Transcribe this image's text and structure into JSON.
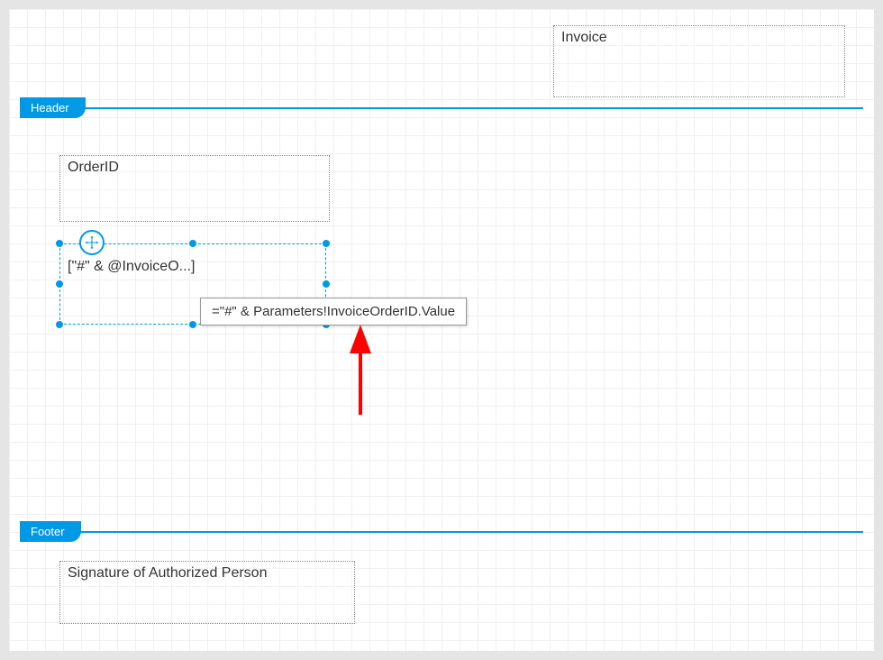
{
  "sections": {
    "header_label": "Header",
    "footer_label": "Footer"
  },
  "header": {
    "invoice_text": "Invoice"
  },
  "body": {
    "orderid_label": "OrderID",
    "expression_display": "[\"#\" & @InvoiceO...]",
    "expression_full": "=\"#\" & Parameters!InvoiceOrderID.Value"
  },
  "footer": {
    "signature_text": "Signature of Authorized Person"
  }
}
